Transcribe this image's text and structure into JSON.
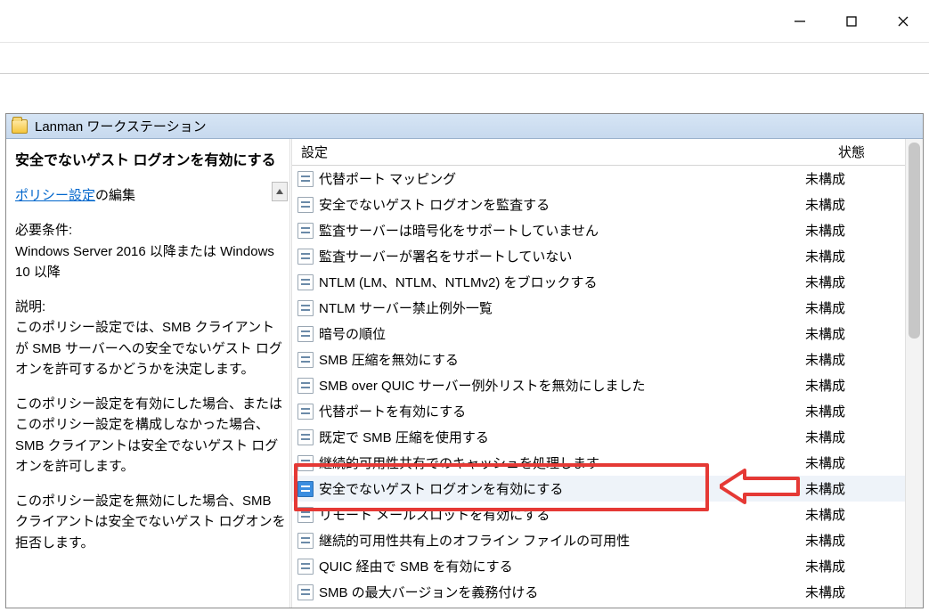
{
  "titlebar": {},
  "header": {
    "title": "Lanman ワークステーション"
  },
  "details": {
    "selected_title": "安全でないゲスト ログオンを有効にする",
    "edit_link": "ポリシー設定",
    "edit_suffix": "の編集",
    "req_label": "必要条件:",
    "req_text": "Windows Server 2016 以降または Windows 10 以降",
    "desc_label": "説明:",
    "desc_p1": "このポリシー設定では、SMB クライアントが SMB サーバーへの安全でないゲスト ログオンを許可するかどうかを決定します。",
    "desc_p2": "このポリシー設定を有効にした場合、またはこのポリシー設定を構成しなかった場合、SMB クライアントは安全でないゲスト ログオンを許可します。",
    "desc_p3": "このポリシー設定を無効にした場合、SMB クライアントは安全でないゲスト ログオンを拒否します。"
  },
  "columns": {
    "name": "設定",
    "state": "状態"
  },
  "state_unconfigured": "未構成",
  "items": [
    {
      "label": "代替ポート マッピング",
      "state": "未構成"
    },
    {
      "label": "安全でないゲスト ログオンを監査する",
      "state": "未構成"
    },
    {
      "label": "監査サーバーは暗号化をサポートしていません",
      "state": "未構成"
    },
    {
      "label": "監査サーバーが署名をサポートしていない",
      "state": "未構成"
    },
    {
      "label": "NTLM (LM、NTLM、NTLMv2) をブロックする",
      "state": "未構成"
    },
    {
      "label": "NTLM サーバー禁止例外一覧",
      "state": "未構成"
    },
    {
      "label": "暗号の順位",
      "state": "未構成"
    },
    {
      "label": "SMB 圧縮を無効にする",
      "state": "未構成"
    },
    {
      "label": "SMB over QUIC サーバー例外リストを無効にしました",
      "state": "未構成"
    },
    {
      "label": "代替ポートを有効にする",
      "state": "未構成"
    },
    {
      "label": "既定で SMB 圧縮を使用する",
      "state": "未構成"
    },
    {
      "label": "継続的可用性共有でのキャッシュを処理します",
      "state": "未構成"
    },
    {
      "label": "安全でないゲスト ログオンを有効にする",
      "state": "未構成",
      "selected": true
    },
    {
      "label": "リモート メールスロットを有効にする",
      "state": "未構成"
    },
    {
      "label": "継続的可用性共有上のオフライン ファイルの可用性",
      "state": "未構成"
    },
    {
      "label": "QUIC 経由で SMB を有効にする",
      "state": "未構成"
    },
    {
      "label": "SMB の最大バージョンを義務付ける",
      "state": "未構成"
    }
  ]
}
